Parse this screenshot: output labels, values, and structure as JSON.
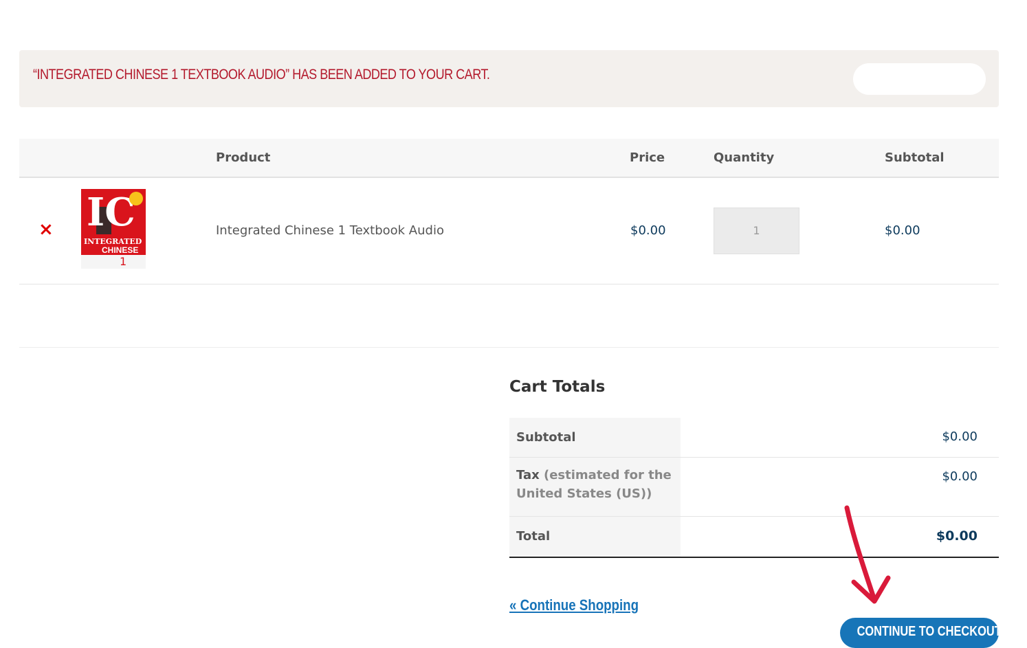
{
  "notice": {
    "message": "“INTEGRATED CHINESE 1 TEXTBOOK AUDIO” HAS BEEN ADDED TO YOUR CART.",
    "button_label": ""
  },
  "cart": {
    "headers": {
      "product": "Product",
      "price": "Price",
      "quantity": "Quantity",
      "subtotal": "Subtotal"
    },
    "items": [
      {
        "remove_symbol": "×",
        "thumbnail": {
          "logo": "IC",
          "title_line1": "INTEGRATED",
          "title_line2": "CHINESE",
          "volume": "1"
        },
        "name": "Integrated Chinese 1 Textbook Audio",
        "price": "$0.00",
        "quantity": "1",
        "subtotal": "$0.00"
      }
    ]
  },
  "totals": {
    "title": "Cart Totals",
    "subtotal_label": "Subtotal",
    "subtotal_value": "$0.00",
    "tax_label": "Tax",
    "tax_note": "(estimated for the United States (US))",
    "tax_value": "$0.00",
    "total_label": "Total",
    "total_value": "$0.00"
  },
  "actions": {
    "continue_shopping": "« Continue Shopping",
    "checkout": "CONTINUE TO CHECKOUT »"
  },
  "colors": {
    "notice_text": "#b3192c",
    "notice_bg": "#f3f0ed",
    "link": "#1773b8",
    "button": "#1775b8",
    "remove": "#e00000",
    "arrow": "#d91a3a"
  }
}
